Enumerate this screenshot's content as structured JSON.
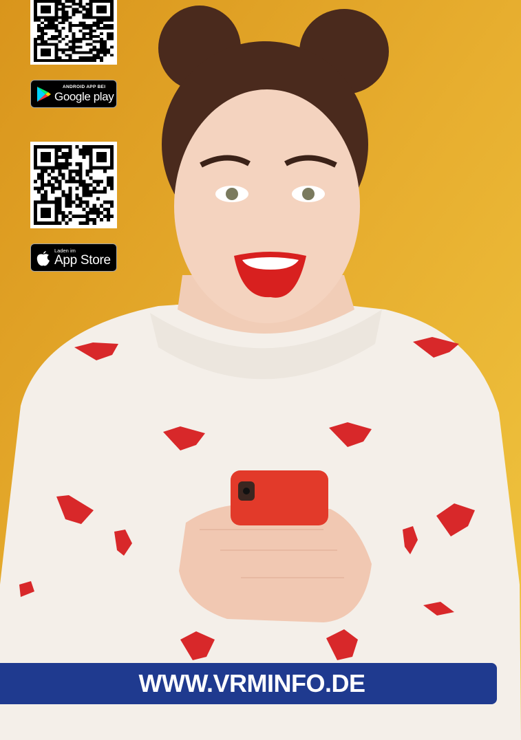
{
  "colors": {
    "background": "#e2a627",
    "banner": "#1f3a8f",
    "badge": "#000000"
  },
  "google_badge": {
    "small_label": "ANDROID APP BEI",
    "big_label": "Google play",
    "icon": "google-play-icon"
  },
  "apple_badge": {
    "small_label": "Laden im",
    "big_label": "App Store",
    "icon": "apple-icon"
  },
  "qr_codes": {
    "android": "qr-code-icon",
    "apple": "qr-code-icon"
  },
  "banner": {
    "text": "WWW.VRMINFO.DE"
  },
  "photo": {
    "subject": "woman-with-phone-image"
  }
}
